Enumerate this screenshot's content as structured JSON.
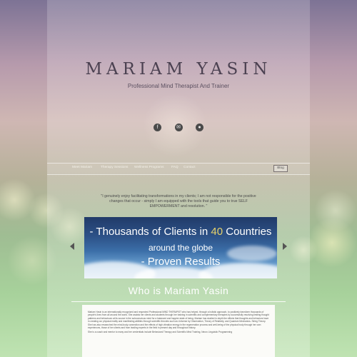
{
  "brand": {
    "name": "MARIAM YASIN",
    "tagline": "Professional Mind Therapist And Trainer"
  },
  "social": [
    "facebook-icon",
    "email-icon",
    "chat-icon"
  ],
  "nav": {
    "items": [
      "Meet Mariam",
      "Therapy Sessions",
      "Wellness Programs",
      "FAQ",
      "Contact"
    ],
    "blog_label": "Blog"
  },
  "quote": {
    "text": "\"I genuinely enjoy facilitating transformations in my clients; I am not responsible for the positive changes that occur - simply I am equipped with the tools that guide you to true SELF EMPOWERMENT and resolution. \""
  },
  "slider": {
    "line1_prefix": "- Thousands of Clients in",
    "line1_number": "40",
    "line1_suffix": "Countries",
    "line2": "around the globe",
    "line3": "- Proven Results",
    "number_color": "#e8d36a"
  },
  "about": {
    "title": "Who is Mariam Yasin",
    "paragraphs": [
      "Mariam Yasin is an internationally recognized and respected Professional MIND THERAPIST who has helped, through a holistic approach, to positively transform thousands of people's lives from all around the world. She assists her clients and students through her training in scientific and complementary therapies by successfully resolving limiting thought patterns and behaviours at its source in the subconscious mind for a balanced and happier state of being. Mariam has studied in depth the effects that thoughts and behaviors have in creating our physical reality and manifesting abilities through scientific theories such as Universe by Observation, Theory of Relativity, and Quantum Mechanics- String Theory.",
      "She has also researched the mind-body connection and the effects of high vibration energy in the regeneration process and well-being of the physical body through her own experiences, those of her clients and from leading experts in the field in present day and throughout history.",
      "She is a coach and mentor to many and her credentials include Behavioral Therapy and Scientific Mind Training, Neuro Linguistic Programming"
    ]
  }
}
